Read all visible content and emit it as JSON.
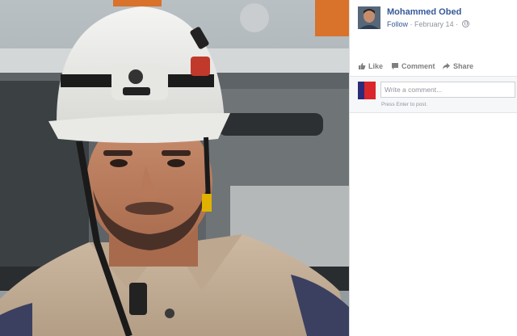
{
  "post": {
    "author_name": "Mohammed Obed",
    "follow_label": "Follow",
    "separator": "·",
    "date": "February 14",
    "privacy_icon": "globe-icon"
  },
  "actions": {
    "like_label": "Like",
    "comment_label": "Comment",
    "share_label": "Share"
  },
  "comment_box": {
    "placeholder": "Write a comment...",
    "hint": "Press Enter to post."
  },
  "colors": {
    "link": "#365899",
    "meta": "#90949c",
    "action": "#7f7f7f"
  }
}
